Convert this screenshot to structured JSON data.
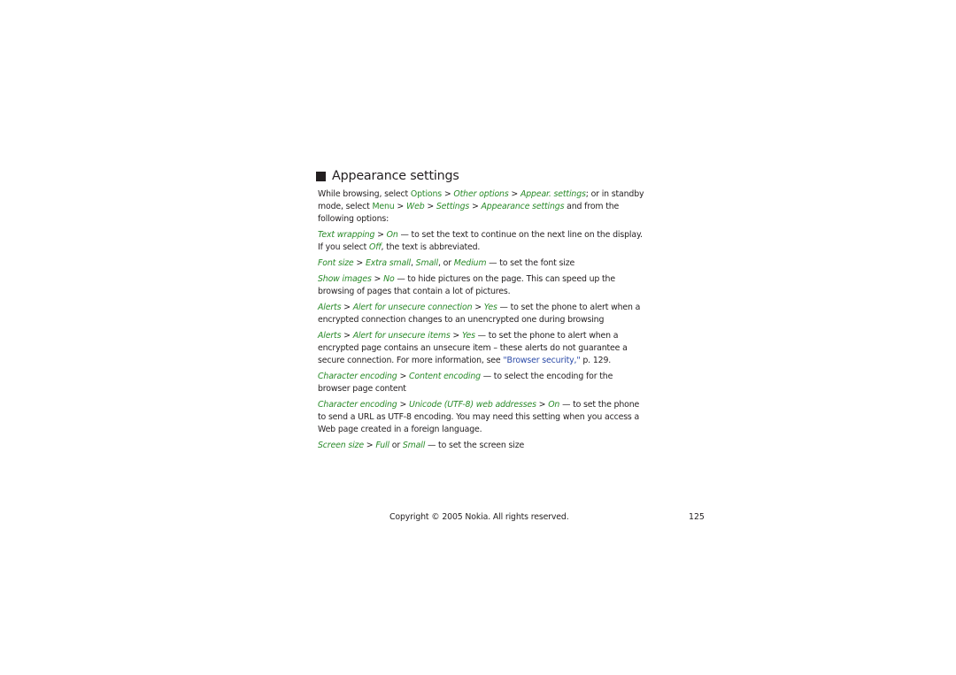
{
  "heading": {
    "icon": "black-square",
    "title": "Appearance settings"
  },
  "intro": {
    "t1": "While browsing, select ",
    "options": "Options",
    "sep": " > ",
    "other_options": "Other options",
    "appear": "Appear. settings",
    "t2": "; or in standby mode, select ",
    "menu": "Menu",
    "web": "Web",
    "settings": "Settings",
    "appearance_settings": "Appearance settings",
    "t3": " and from the following options:"
  },
  "items": [
    {
      "path": [
        "Text wrapping",
        "On"
      ],
      "text": " — to set the text to continue on the next line on the display. If you select ",
      "off": "Off",
      "text2": ", the text is abbreviated."
    },
    {
      "a": "Font size",
      "b": "Extra small",
      "c": "Small",
      "d": "Medium",
      "text": " — to set the font size"
    },
    {
      "path": [
        "Show images",
        "No"
      ],
      "text": " — to hide pictures on the page. This can speed up the browsing of pages that contain a lot of pictures."
    },
    {
      "path": [
        "Alerts",
        "Alert for unsecure connection",
        "Yes"
      ],
      "text": " — to set the phone to alert when a encrypted connection changes to an unencrypted one during browsing"
    },
    {
      "path": [
        "Alerts",
        "Alert for unsecure items",
        "Yes"
      ],
      "text": " — to set the phone to alert when a encrypted page contains an unsecure item – these alerts do not guarantee a secure connection. For more information, see ",
      "link": "\"Browser security,\"",
      "page_ref": " p. 129."
    },
    {
      "path": [
        "Character encoding",
        "Content encoding"
      ],
      "text": " — to select the encoding for the browser page content"
    },
    {
      "path": [
        "Character encoding",
        "Unicode (UTF-8) web addresses",
        "On"
      ],
      "text": " — to set the phone to send a URL as UTF-8 encoding. You may need this setting when you access a Web page created in a foreign language."
    },
    {
      "a": "Screen size",
      "b": "Full",
      "c": "Small",
      "text": " — to set the screen size"
    }
  ],
  "footer": {
    "copyright": "Copyright © 2005 Nokia. All rights reserved.",
    "page_number": "125"
  },
  "colors": {
    "menu_green": "#2a8a2a",
    "link_blue": "#2b4aa8",
    "text": "#231f20"
  }
}
